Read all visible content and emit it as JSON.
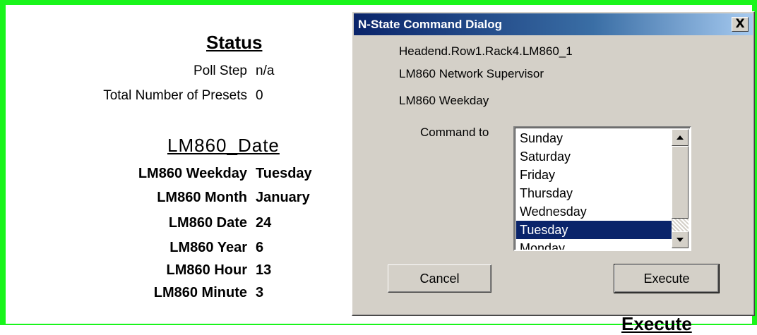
{
  "status": {
    "title": "Status",
    "rows": [
      {
        "label": "Poll Step",
        "value": "n/a"
      },
      {
        "label": "Total Number of Presets",
        "value": "0"
      }
    ]
  },
  "date_section": {
    "title": "LM860_Date",
    "rows": [
      {
        "label": "LM860 Weekday",
        "value": "Tuesday"
      },
      {
        "label": "LM860 Month",
        "value": "January"
      },
      {
        "label": "LM860 Date",
        "value": "24"
      },
      {
        "label": "LM860 Year",
        "value": "6"
      },
      {
        "label": "LM860 Hour",
        "value": "13"
      },
      {
        "label": "LM860 Minute",
        "value": "3"
      }
    ]
  },
  "background_execute_label": "Execute",
  "dialog": {
    "title": "N-State Command Dialog",
    "close_label": "X",
    "object_path": "Headend.Row1.Rack4.LM860_1",
    "device_type": "LM860 Network Supervisor",
    "point_name": "LM860 Weekday",
    "command_label": "Command to",
    "options": [
      "Sunday",
      "Saturday",
      "Friday",
      "Thursday",
      "Wednesday",
      "Tuesday",
      "Monday"
    ],
    "selected_option": "Tuesday",
    "cancel_label": "Cancel",
    "execute_label": "Execute"
  },
  "colors": {
    "frame": "#19f51b",
    "title_bar": "#0a246a",
    "selection": "#0a246a",
    "dialog_face": "#d4d0c8"
  }
}
